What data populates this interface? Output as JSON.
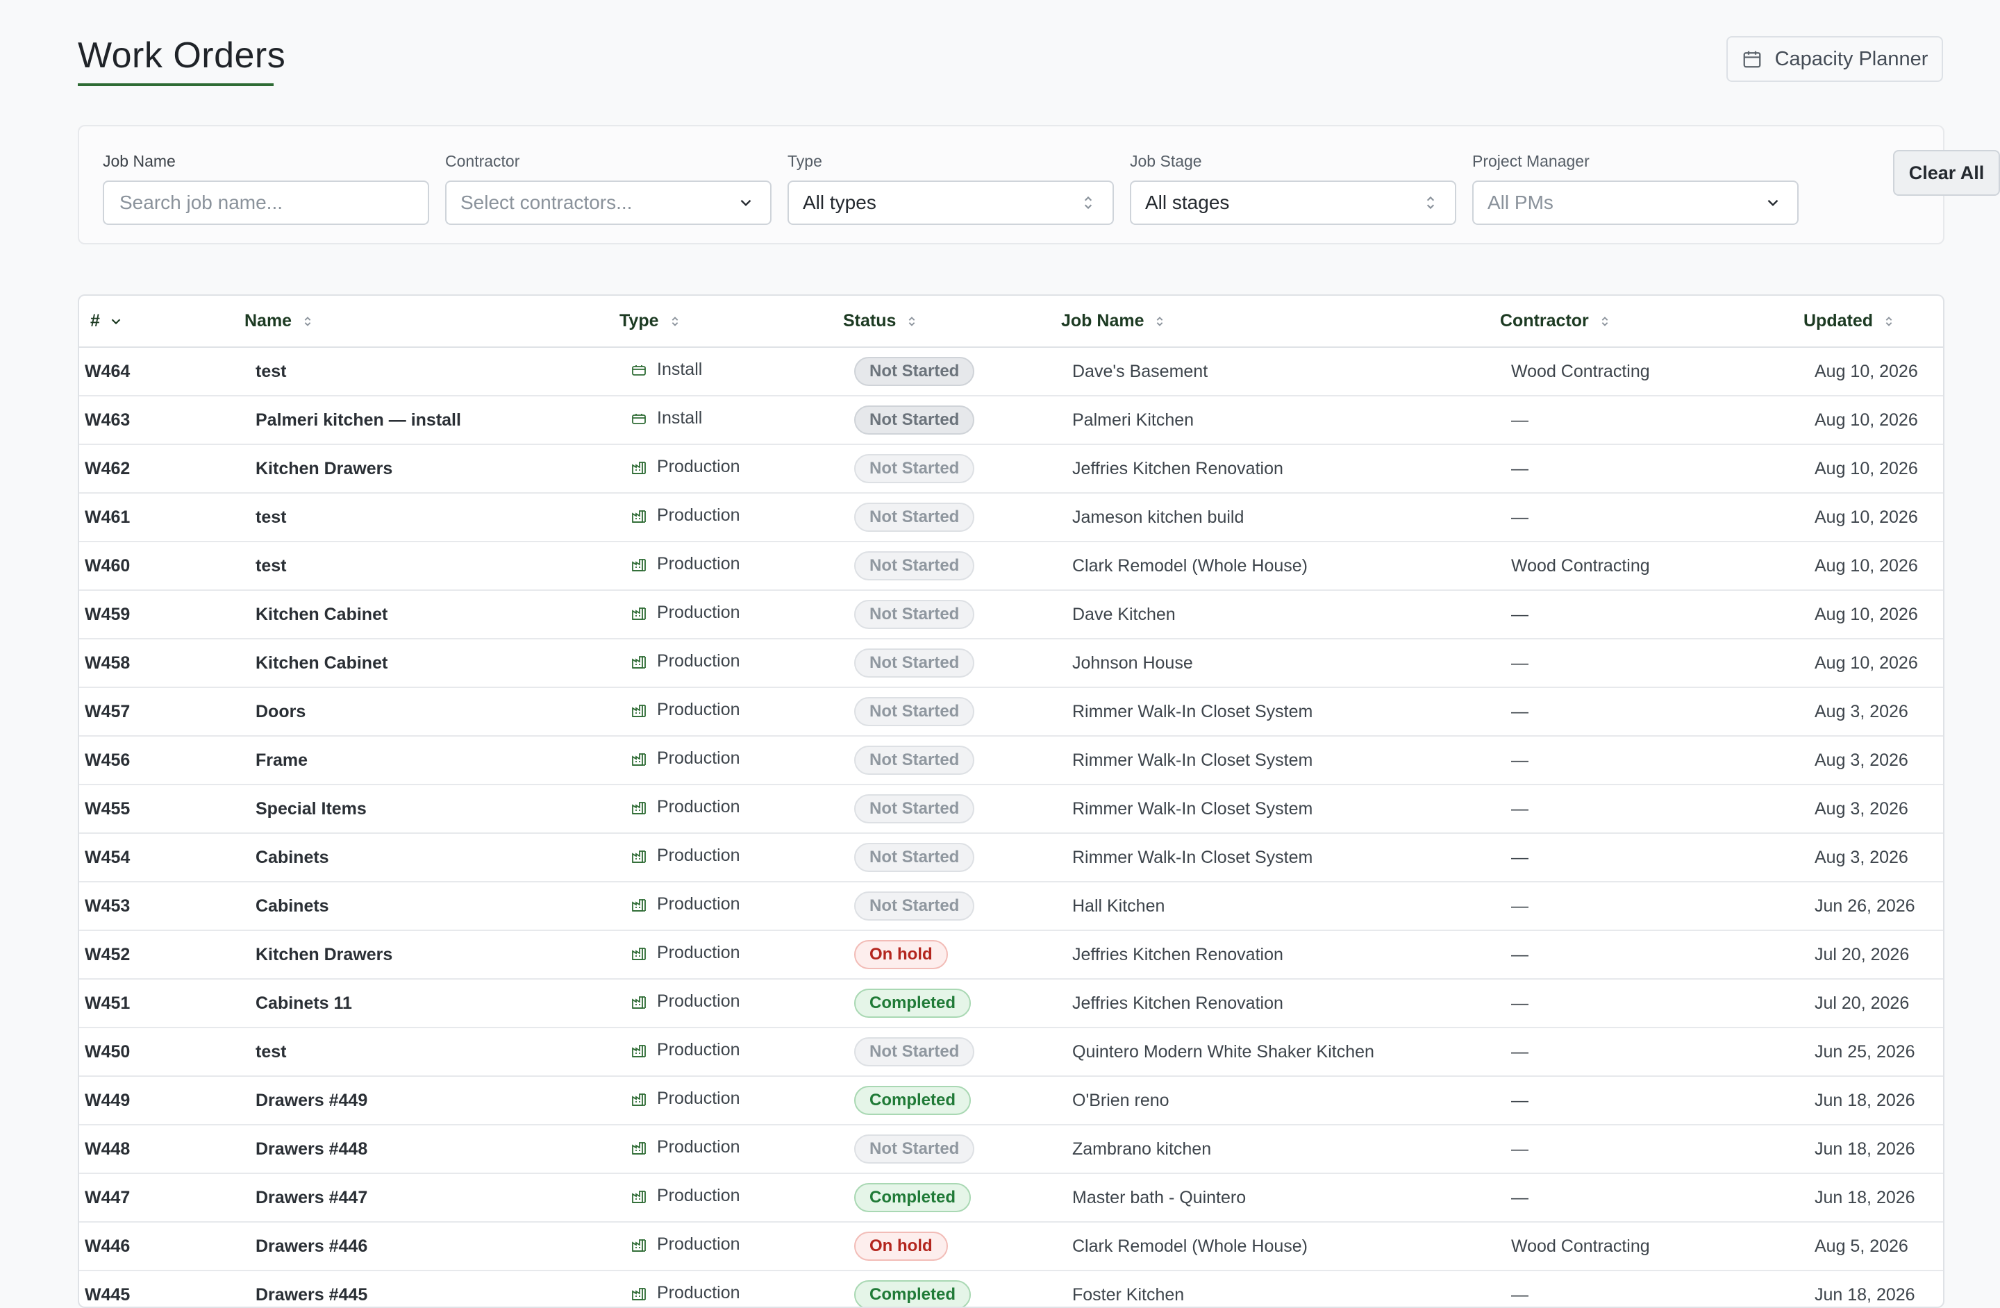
{
  "header": {
    "title": "Work Orders",
    "capacity_button": {
      "label": "Capacity Planner",
      "icon": "calendar-icon"
    }
  },
  "filters": {
    "job_name": {
      "label": "Job Name",
      "placeholder": "Search job name..."
    },
    "contractor": {
      "label": "Contractor",
      "value": "Select contractors..."
    },
    "type": {
      "label": "Type",
      "value": "All types"
    },
    "job_stage": {
      "label": "Job Stage",
      "value": "All stages"
    },
    "project_manager": {
      "label": "Project Manager",
      "value": "All PMs"
    },
    "clear_label": "Clear All"
  },
  "table": {
    "columns": {
      "num": "#",
      "name": "Name",
      "type": "Type",
      "status": "Status",
      "job": "Job Name",
      "contractor": "Contractor",
      "updated": "Updated"
    },
    "rows": [
      {
        "num": "W464",
        "name": "test",
        "type": "Install",
        "status": "Not Started",
        "job": "Dave's Basement",
        "contractor": "Wood Contracting",
        "updated": "Aug 10, 2026"
      },
      {
        "num": "W463",
        "name": "Palmeri kitchen — install",
        "type": "Install",
        "status": "Not Started",
        "job": "Palmeri Kitchen",
        "contractor": "—",
        "updated": "Aug 10, 2026"
      },
      {
        "num": "W462",
        "name": "Kitchen Drawers",
        "type": "Production",
        "status": "Not Started",
        "job": "Jeffries Kitchen Renovation",
        "contractor": "—",
        "updated": "Aug 10, 2026"
      },
      {
        "num": "W461",
        "name": "test",
        "type": "Production",
        "status": "Not Started",
        "job": "Jameson kitchen build",
        "contractor": "—",
        "updated": "Aug 10, 2026"
      },
      {
        "num": "W460",
        "name": "test",
        "type": "Production",
        "status": "Not Started",
        "job": "Clark Remodel (Whole House)",
        "contractor": "Wood Contracting",
        "updated": "Aug 10, 2026"
      },
      {
        "num": "W459",
        "name": "Kitchen Cabinet",
        "type": "Production",
        "status": "Not Started",
        "job": "Dave Kitchen",
        "contractor": "—",
        "updated": "Aug 10, 2026"
      },
      {
        "num": "W458",
        "name": "Kitchen Cabinet",
        "type": "Production",
        "status": "Not Started",
        "job": "Johnson House",
        "contractor": "—",
        "updated": "Aug 10, 2026"
      },
      {
        "num": "W457",
        "name": "Doors",
        "type": "Production",
        "status": "Not Started",
        "job": "Rimmer Walk-In Closet System",
        "contractor": "—",
        "updated": "Aug 3, 2026"
      },
      {
        "num": "W456",
        "name": "Frame",
        "type": "Production",
        "status": "Not Started",
        "job": "Rimmer Walk-In Closet System",
        "contractor": "—",
        "updated": "Aug 3, 2026"
      },
      {
        "num": "W455",
        "name": "Special Items",
        "type": "Production",
        "status": "Not Started",
        "job": "Rimmer Walk-In Closet System",
        "contractor": "—",
        "updated": "Aug 3, 2026"
      },
      {
        "num": "W454",
        "name": "Cabinets",
        "type": "Production",
        "status": "Not Started",
        "job": "Rimmer Walk-In Closet System",
        "contractor": "—",
        "updated": "Aug 3, 2026"
      },
      {
        "num": "W453",
        "name": "Cabinets",
        "type": "Production",
        "status": "Not Started",
        "job": "Hall Kitchen",
        "contractor": "—",
        "updated": "Jun 26, 2026"
      },
      {
        "num": "W452",
        "name": "Kitchen Drawers",
        "type": "Production",
        "status": "On hold",
        "job": "Jeffries Kitchen Renovation",
        "contractor": "—",
        "updated": "Jul 20, 2026"
      },
      {
        "num": "W451",
        "name": "Cabinets 11",
        "type": "Production",
        "status": "Completed",
        "job": "Jeffries Kitchen Renovation",
        "contractor": "—",
        "updated": "Jul 20, 2026"
      },
      {
        "num": "W450",
        "name": "test",
        "type": "Production",
        "status": "Not Started",
        "job": "Quintero Modern White Shaker Kitchen",
        "contractor": "—",
        "updated": "Jun 25, 2026"
      },
      {
        "num": "W449",
        "name": "Drawers #449",
        "type": "Production",
        "status": "Completed",
        "job": "O'Brien reno",
        "contractor": "—",
        "updated": "Jun 18, 2026"
      },
      {
        "num": "W448",
        "name": "Drawers #448",
        "type": "Production",
        "status": "Not Started",
        "job": "Zambrano kitchen",
        "contractor": "—",
        "updated": "Jun 18, 2026"
      },
      {
        "num": "W447",
        "name": "Drawers #447",
        "type": "Production",
        "status": "Completed",
        "job": "Master bath - Quintero",
        "contractor": "—",
        "updated": "Jun 18, 2026"
      },
      {
        "num": "W446",
        "name": "Drawers #446",
        "type": "Production",
        "status": "On hold",
        "job": "Clark Remodel (Whole House)",
        "contractor": "Wood Contracting",
        "updated": "Aug 5, 2026"
      },
      {
        "num": "W445",
        "name": "Drawers #445",
        "type": "Production",
        "status": "Completed",
        "job": "Foster Kitchen",
        "contractor": "—",
        "updated": "Jun 18, 2026"
      }
    ]
  },
  "colors": {
    "accent": "#2e6b34",
    "completed": "#207a37",
    "on_hold": "#b3261e",
    "not_started": "#8f979f"
  }
}
